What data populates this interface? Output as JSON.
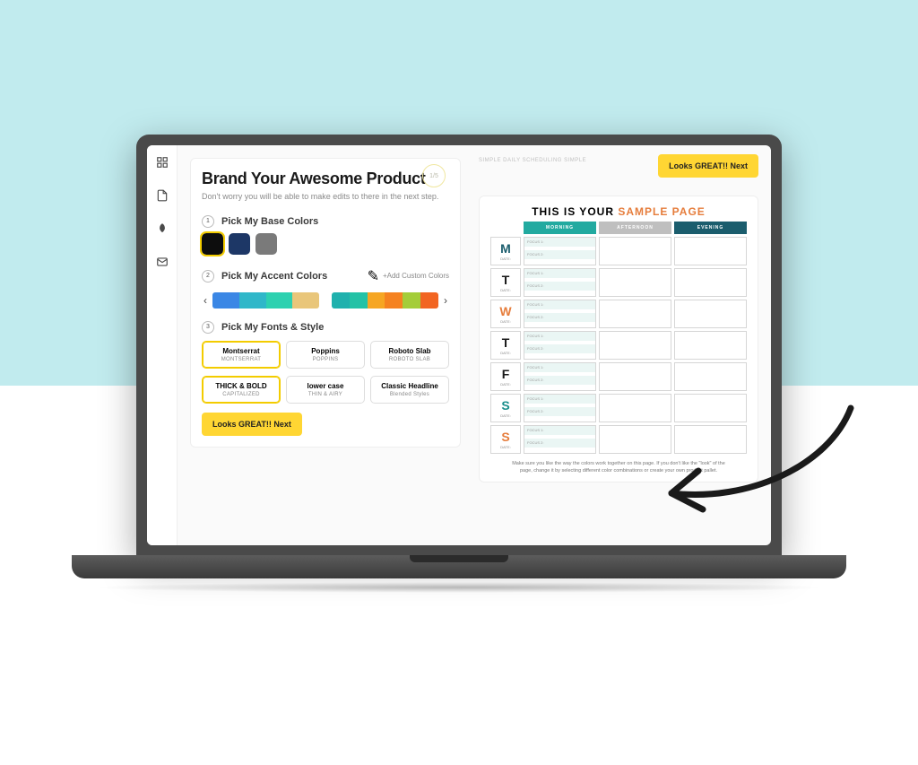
{
  "header": {
    "title": "Brand Your Awesome Product",
    "subtitle": "Don't worry you will be able to make edits to there in the next step.",
    "step_badge": "1/5"
  },
  "sections": {
    "base": {
      "num": "1",
      "title": "Pick My Base Colors",
      "swatches": [
        "#0d0d0d",
        "#1d3766",
        "#7a7a7a"
      ]
    },
    "accent": {
      "num": "2",
      "title": "Pick My Accent Colors",
      "add_label": "Add Custom Colors",
      "strips": [
        [
          "#3b87e5",
          "#2fb7c9",
          "#2dd1b0",
          "#e9c67a"
        ],
        [
          "#1fb1ad",
          "#23c2a6",
          "#f6a623",
          "#f58220",
          "#a4cd39",
          "#f26522"
        ]
      ]
    },
    "fonts": {
      "num": "3",
      "title": "Pick My Fonts & Style",
      "row1": [
        {
          "l1": "Montserrat",
          "l2": "MONTSERRAT",
          "selected": true
        },
        {
          "l1": "Poppins",
          "l2": "POPPINS",
          "selected": false
        },
        {
          "l1": "Roboto Slab",
          "l2": "ROBOTO SLAB",
          "selected": false
        }
      ],
      "row2": [
        {
          "l1": "THICK & BOLD",
          "l2": "CAPITALIZED",
          "selected": true
        },
        {
          "l1": "lower case",
          "l2": "THIN & AIRY",
          "selected": false
        },
        {
          "l1": "Classic Headline",
          "l2": "Blended Styles",
          "selected": false
        }
      ]
    }
  },
  "cta": {
    "next": "Looks GREAT!! Next"
  },
  "preview": {
    "tag": "SIMPLE DAILY SCHEDULING SIMPLE",
    "title_pre": "THIS IS YOUR ",
    "title_accent": "SAMPLE PAGE",
    "headers": {
      "morning": "MORNING",
      "afternoon": "AFTERNOON",
      "evening": "EVENING"
    },
    "days": [
      {
        "d": "M",
        "color": "#1b5d6d"
      },
      {
        "d": "T",
        "color": "#1a1a1a"
      },
      {
        "d": "W",
        "color": "#e67d3c"
      },
      {
        "d": "T",
        "color": "#1a1a1a"
      },
      {
        "d": "F",
        "color": "#1a1a1a"
      },
      {
        "d": "S",
        "color": "#1b8f8c"
      },
      {
        "d": "S",
        "color": "#e67d3c"
      }
    ],
    "date_label": "DATE:",
    "focus1": "FOCUS 1:",
    "focus2": "FOCUS 2:",
    "note": "Make sure you like the way the colors work together on this page. If you don't like the \"look\" of the page, change it by selecting different color combinations or create your own product pallet."
  }
}
